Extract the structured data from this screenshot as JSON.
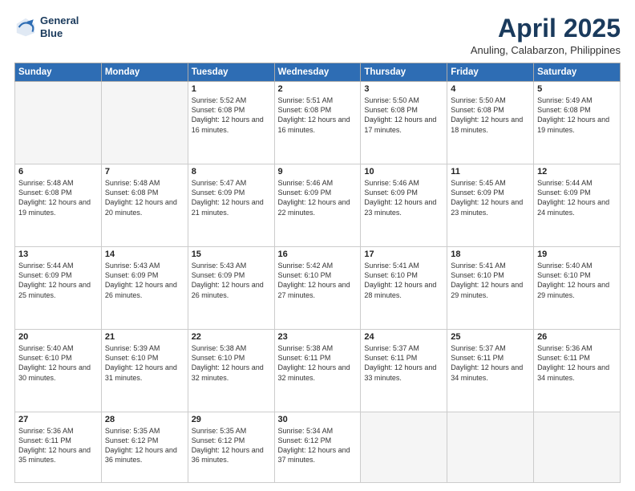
{
  "header": {
    "logo_line1": "General",
    "logo_line2": "Blue",
    "month": "April 2025",
    "location": "Anuling, Calabarzon, Philippines"
  },
  "days_of_week": [
    "Sunday",
    "Monday",
    "Tuesday",
    "Wednesday",
    "Thursday",
    "Friday",
    "Saturday"
  ],
  "weeks": [
    [
      {
        "day": "",
        "empty": true
      },
      {
        "day": "",
        "empty": true
      },
      {
        "day": "1",
        "sunrise": "5:52 AM",
        "sunset": "6:08 PM",
        "daylight": "12 hours and 16 minutes."
      },
      {
        "day": "2",
        "sunrise": "5:51 AM",
        "sunset": "6:08 PM",
        "daylight": "12 hours and 16 minutes."
      },
      {
        "day": "3",
        "sunrise": "5:50 AM",
        "sunset": "6:08 PM",
        "daylight": "12 hours and 17 minutes."
      },
      {
        "day": "4",
        "sunrise": "5:50 AM",
        "sunset": "6:08 PM",
        "daylight": "12 hours and 18 minutes."
      },
      {
        "day": "5",
        "sunrise": "5:49 AM",
        "sunset": "6:08 PM",
        "daylight": "12 hours and 19 minutes."
      }
    ],
    [
      {
        "day": "6",
        "sunrise": "5:48 AM",
        "sunset": "6:08 PM",
        "daylight": "12 hours and 19 minutes."
      },
      {
        "day": "7",
        "sunrise": "5:48 AM",
        "sunset": "6:08 PM",
        "daylight": "12 hours and 20 minutes."
      },
      {
        "day": "8",
        "sunrise": "5:47 AM",
        "sunset": "6:09 PM",
        "daylight": "12 hours and 21 minutes."
      },
      {
        "day": "9",
        "sunrise": "5:46 AM",
        "sunset": "6:09 PM",
        "daylight": "12 hours and 22 minutes."
      },
      {
        "day": "10",
        "sunrise": "5:46 AM",
        "sunset": "6:09 PM",
        "daylight": "12 hours and 23 minutes."
      },
      {
        "day": "11",
        "sunrise": "5:45 AM",
        "sunset": "6:09 PM",
        "daylight": "12 hours and 23 minutes."
      },
      {
        "day": "12",
        "sunrise": "5:44 AM",
        "sunset": "6:09 PM",
        "daylight": "12 hours and 24 minutes."
      }
    ],
    [
      {
        "day": "13",
        "sunrise": "5:44 AM",
        "sunset": "6:09 PM",
        "daylight": "12 hours and 25 minutes."
      },
      {
        "day": "14",
        "sunrise": "5:43 AM",
        "sunset": "6:09 PM",
        "daylight": "12 hours and 26 minutes."
      },
      {
        "day": "15",
        "sunrise": "5:43 AM",
        "sunset": "6:09 PM",
        "daylight": "12 hours and 26 minutes."
      },
      {
        "day": "16",
        "sunrise": "5:42 AM",
        "sunset": "6:10 PM",
        "daylight": "12 hours and 27 minutes."
      },
      {
        "day": "17",
        "sunrise": "5:41 AM",
        "sunset": "6:10 PM",
        "daylight": "12 hours and 28 minutes."
      },
      {
        "day": "18",
        "sunrise": "5:41 AM",
        "sunset": "6:10 PM",
        "daylight": "12 hours and 29 minutes."
      },
      {
        "day": "19",
        "sunrise": "5:40 AM",
        "sunset": "6:10 PM",
        "daylight": "12 hours and 29 minutes."
      }
    ],
    [
      {
        "day": "20",
        "sunrise": "5:40 AM",
        "sunset": "6:10 PM",
        "daylight": "12 hours and 30 minutes."
      },
      {
        "day": "21",
        "sunrise": "5:39 AM",
        "sunset": "6:10 PM",
        "daylight": "12 hours and 31 minutes."
      },
      {
        "day": "22",
        "sunrise": "5:38 AM",
        "sunset": "6:10 PM",
        "daylight": "12 hours and 32 minutes."
      },
      {
        "day": "23",
        "sunrise": "5:38 AM",
        "sunset": "6:11 PM",
        "daylight": "12 hours and 32 minutes."
      },
      {
        "day": "24",
        "sunrise": "5:37 AM",
        "sunset": "6:11 PM",
        "daylight": "12 hours and 33 minutes."
      },
      {
        "day": "25",
        "sunrise": "5:37 AM",
        "sunset": "6:11 PM",
        "daylight": "12 hours and 34 minutes."
      },
      {
        "day": "26",
        "sunrise": "5:36 AM",
        "sunset": "6:11 PM",
        "daylight": "12 hours and 34 minutes."
      }
    ],
    [
      {
        "day": "27",
        "sunrise": "5:36 AM",
        "sunset": "6:11 PM",
        "daylight": "12 hours and 35 minutes."
      },
      {
        "day": "28",
        "sunrise": "5:35 AM",
        "sunset": "6:12 PM",
        "daylight": "12 hours and 36 minutes."
      },
      {
        "day": "29",
        "sunrise": "5:35 AM",
        "sunset": "6:12 PM",
        "daylight": "12 hours and 36 minutes."
      },
      {
        "day": "30",
        "sunrise": "5:34 AM",
        "sunset": "6:12 PM",
        "daylight": "12 hours and 37 minutes."
      },
      {
        "day": "",
        "empty": true
      },
      {
        "day": "",
        "empty": true
      },
      {
        "day": "",
        "empty": true
      }
    ]
  ]
}
